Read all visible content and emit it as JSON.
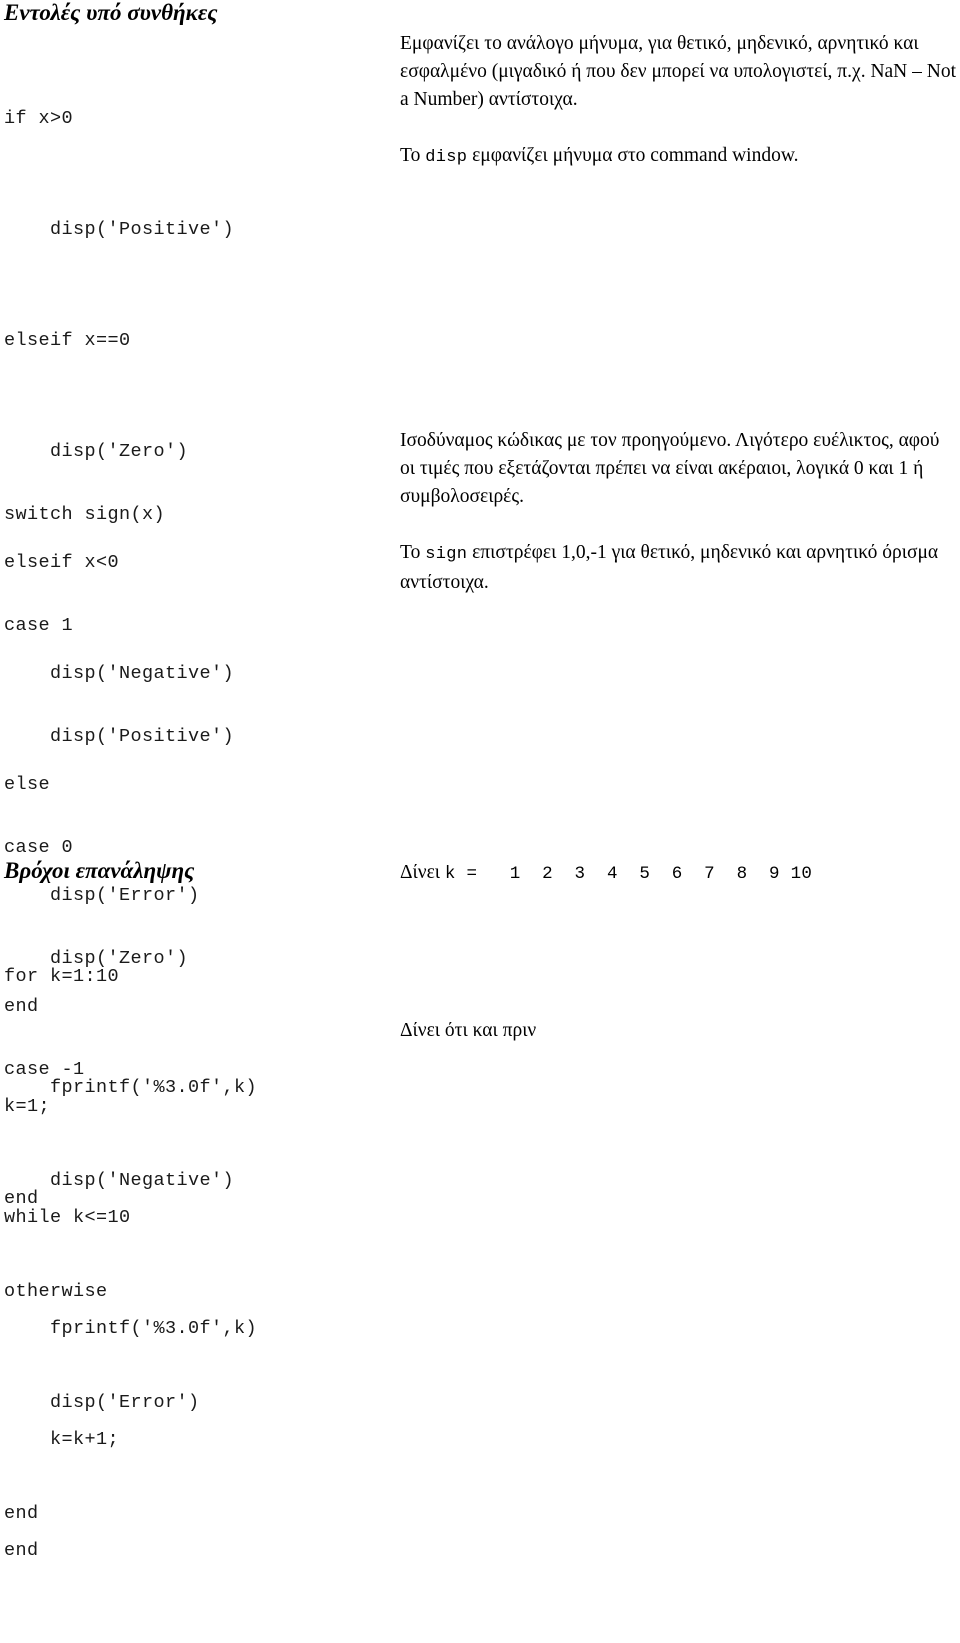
{
  "document": {
    "language": "el",
    "background_color": "#ffffff",
    "text_color": "#000000",
    "code_color": "#1a1a1a"
  },
  "sections": [
    {
      "id": "conditionals",
      "heading": "Εντολές υπό συνθήκες",
      "code_lines": [
        "if x>0",
        "    disp('Positive')",
        "elseif x==0",
        "    disp('Zero')",
        "elseif x<0",
        "    disp('Negative')",
        "else",
        "    disp('Error')",
        "end"
      ],
      "notes": [
        {
          "parts": [
            {
              "text": "Εμφανίζει το ανάλογο μήνυμα, για θετικό, μηδενικό, αρνητικό και εσφαλμένο (μιγαδικό ή που δεν μπορεί να υπολογιστεί, π.χ. NaN – Not a Number) αντίστοιχα.",
              "style": "serif"
            }
          ]
        },
        {
          "parts": [
            {
              "text": "Το ",
              "style": "serif"
            },
            {
              "text": "disp",
              "style": "mono"
            },
            {
              "text": " εμφανίζει μήνυμα στο command window.",
              "style": "serif"
            }
          ]
        }
      ]
    },
    {
      "id": "switch",
      "heading": "",
      "code_lines": [
        "switch sign(x)",
        "case 1",
        "    disp('Positive')",
        "case 0",
        "    disp('Zero')",
        "case -1",
        "    disp('Negative')",
        "otherwise",
        "    disp('Error')",
        "end"
      ],
      "notes": [
        {
          "parts": [
            {
              "text": "Ισοδύναμος κώδικας με τον προηγούμενο. Λιγότερο ευέλικτος, αφού οι τιμές που εξετάζονται πρέπει να είναι ακέραιοι, λογικά 0 και 1 ή συμβολοσειρές.",
              "style": "serif"
            }
          ]
        },
        {
          "parts": [
            {
              "text": "Το ",
              "style": "serif"
            },
            {
              "text": "sign",
              "style": "mono"
            },
            {
              "text": " επιστρέφει 1,0,-1 για θετικό, μηδενικό και αρνητικό όρισμα αντίστοιχα.",
              "style": "serif"
            }
          ]
        }
      ]
    },
    {
      "id": "for-loop",
      "heading": "Βρόχοι επανάληψης",
      "code_lines": [
        "for k=1:10",
        "    fprintf('%3.0f',k)",
        "end"
      ],
      "output": {
        "label": "Δίνει ",
        "sequence": "k =   1  2  3  4  5  6  7  8  9 10"
      }
    },
    {
      "id": "while-loop",
      "heading": "",
      "code_lines": [
        "k=1;",
        "while k<=10",
        "    fprintf('%3.0f',k)",
        "    k=k+1;",
        "end"
      ],
      "output": {
        "label": "Δίνει ότι και πριν",
        "sequence": ""
      }
    }
  ]
}
